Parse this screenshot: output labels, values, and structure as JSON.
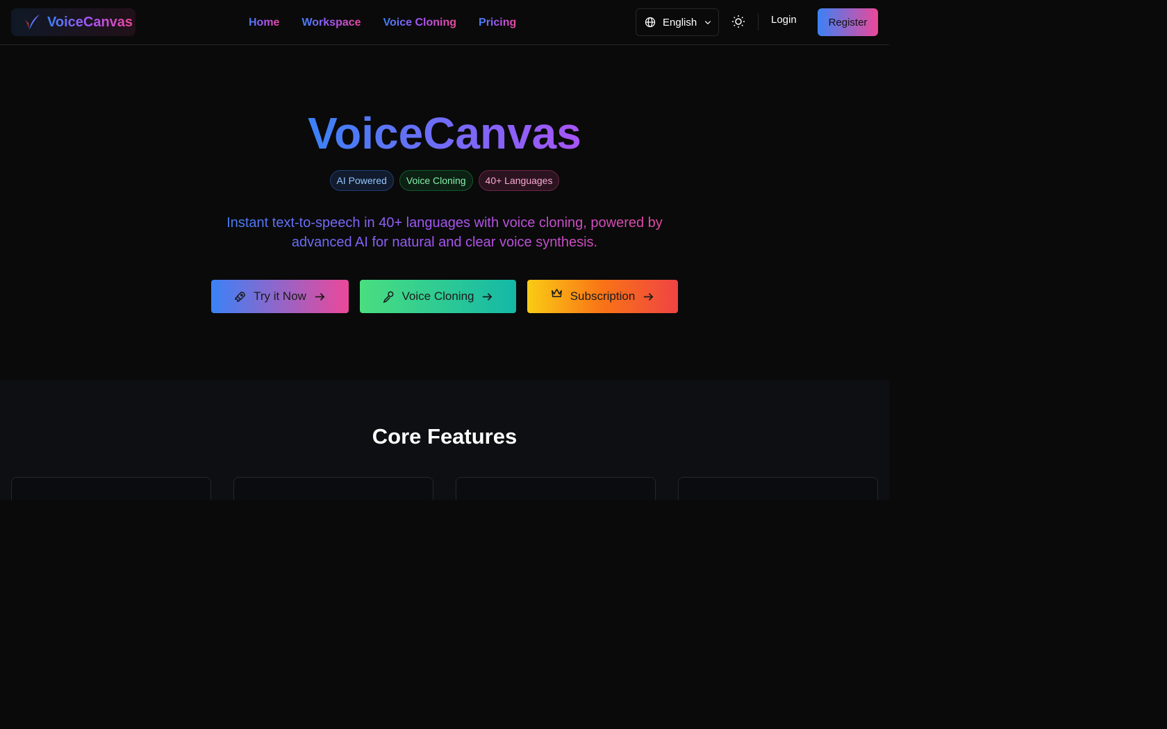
{
  "header": {
    "brand": "VoiceCanvas",
    "nav": [
      "Home",
      "Workspace",
      "Voice Cloning",
      "Pricing"
    ],
    "language": "English",
    "login_label": "Login",
    "register_label": "Register"
  },
  "hero": {
    "title": "VoiceCanvas",
    "badges": [
      "AI Powered",
      "Voice Cloning",
      "40+ Languages"
    ],
    "subtitle": "Instant text-to-speech in 40+ languages with voice cloning, powered by advanced AI for natural and clear voice synthesis.",
    "buttons": [
      "Try it Now",
      "Voice Cloning",
      "Subscription"
    ]
  },
  "features": {
    "title": "Core Features"
  },
  "colors": {
    "background": "#0a0a0a",
    "gradient_blue": "#3b82f6",
    "gradient_purple": "#a855f7",
    "gradient_pink": "#ec4899"
  }
}
